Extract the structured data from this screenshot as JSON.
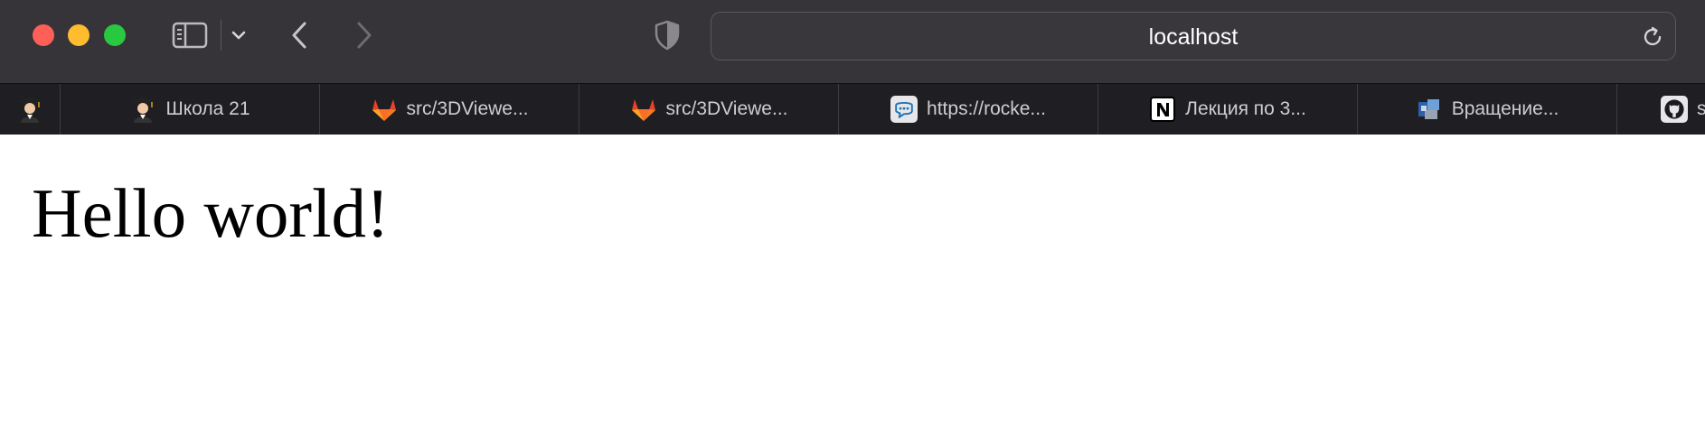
{
  "browser": {
    "address": "localhost"
  },
  "favorites": [
    {
      "label": "",
      "icon": "student-avatar-icon"
    },
    {
      "label": "Школа 21",
      "icon": "student-avatar-icon"
    },
    {
      "label": "src/3DViewe...",
      "icon": "gitlab-icon"
    },
    {
      "label": "src/3DViewe...",
      "icon": "gitlab-icon"
    },
    {
      "label": "https://rocke...",
      "icon": "rocketchat-icon"
    },
    {
      "label": "Лекция по 3...",
      "icon": "notion-icon"
    },
    {
      "label": "Вращение...",
      "icon": "rotation-site-icon"
    },
    {
      "label": "s",
      "icon": "github-icon"
    }
  ],
  "page": {
    "heading": "Hello world!"
  },
  "colors": {
    "toolbar_bg": "#363439",
    "favbar_bg": "#1f1e22",
    "close": "#fe5f57",
    "minimize": "#febc2e",
    "maximize": "#28c840",
    "gitlab": "#e24329"
  }
}
